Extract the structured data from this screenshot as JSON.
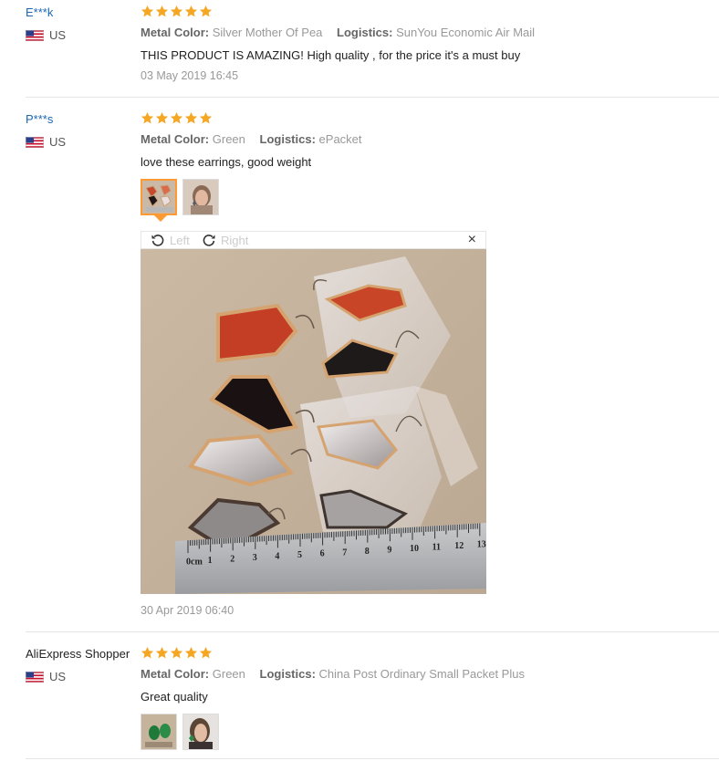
{
  "reviews": [
    {
      "user": "E***k",
      "country": "US",
      "stars": 5,
      "metal_color_label": "Metal Color:",
      "metal_color": "Silver Mother Of Pea",
      "logistics_label": "Logistics:",
      "logistics": "SunYou Economic Air Mail",
      "text": "THIS PRODUCT IS AMAZING! High quality , for the price it's a must buy",
      "date": "03 May 2019 16:45"
    },
    {
      "user": "P***s",
      "country": "US",
      "stars": 5,
      "metal_color_label": "Metal Color:",
      "metal_color": "Green",
      "logistics_label": "Logistics:",
      "logistics": "ePacket",
      "text": "love these earrings, good weight",
      "date": "30 Apr 2019 06:40",
      "photo_count": 2,
      "viewer": {
        "rotate_left": "Left",
        "rotate_right": "Right",
        "close": "×"
      },
      "ruler_numbers": [
        "0cm",
        "1",
        "2",
        "3",
        "4",
        "5",
        "6",
        "7",
        "8",
        "9",
        "10",
        "11",
        "12",
        "13"
      ]
    },
    {
      "user": "AliExpress Shopper",
      "country": "US",
      "stars": 5,
      "metal_color_label": "Metal Color:",
      "metal_color": "Green",
      "logistics_label": "Logistics:",
      "logistics": "China Post Ordinary Small Packet Plus",
      "text": "Great quality",
      "photo_count": 2
    }
  ],
  "colors": {
    "username": "#1b67b1",
    "star": "#f5a623",
    "active_thumb": "#ff9a33",
    "muted": "#999999"
  },
  "icons": [
    "us-flag-icon",
    "star-icon",
    "rotate-left-icon",
    "rotate-right-icon",
    "close-icon"
  ]
}
